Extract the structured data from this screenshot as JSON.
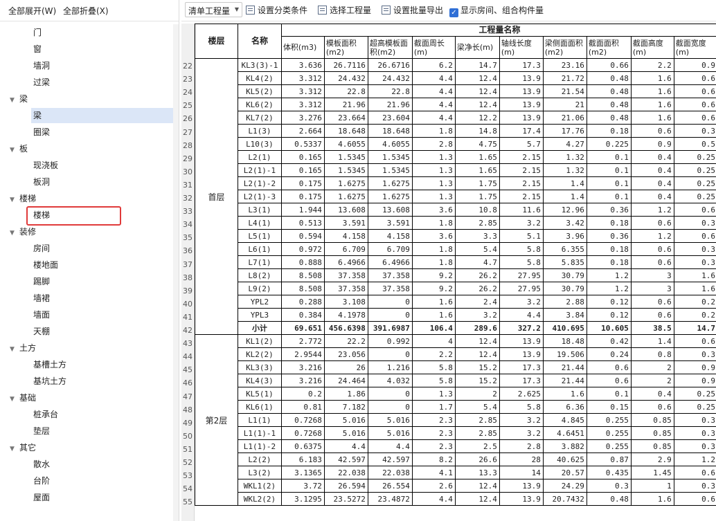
{
  "left_toolbar": {
    "expand_all": "全部展开(W)",
    "collapse_all": "全部折叠(X)"
  },
  "tree": [
    {
      "type": "child",
      "label": "门"
    },
    {
      "type": "child",
      "label": "窗"
    },
    {
      "type": "child",
      "label": "墙洞"
    },
    {
      "type": "child",
      "label": "过梁"
    },
    {
      "type": "parent",
      "label": "梁"
    },
    {
      "type": "child",
      "label": "梁",
      "selected": true
    },
    {
      "type": "child",
      "label": "圈梁"
    },
    {
      "type": "parent",
      "label": "板"
    },
    {
      "type": "child",
      "label": "现浇板"
    },
    {
      "type": "child",
      "label": "板洞"
    },
    {
      "type": "parent",
      "label": "楼梯"
    },
    {
      "type": "child",
      "label": "楼梯",
      "highlighted": true
    },
    {
      "type": "parent",
      "label": "装修"
    },
    {
      "type": "child",
      "label": "房间"
    },
    {
      "type": "child",
      "label": "楼地面"
    },
    {
      "type": "child",
      "label": "踢脚"
    },
    {
      "type": "child",
      "label": "墙裙"
    },
    {
      "type": "child",
      "label": "墙面"
    },
    {
      "type": "child",
      "label": "天棚"
    },
    {
      "type": "parent",
      "label": "土方"
    },
    {
      "type": "child",
      "label": "基槽土方"
    },
    {
      "type": "child",
      "label": "基坑土方"
    },
    {
      "type": "parent",
      "label": "基础"
    },
    {
      "type": "child",
      "label": "桩承台"
    },
    {
      "type": "child",
      "label": "垫层"
    },
    {
      "type": "parent",
      "label": "其它"
    },
    {
      "type": "child",
      "label": "散水"
    },
    {
      "type": "child",
      "label": "台阶"
    },
    {
      "type": "child",
      "label": "屋面"
    }
  ],
  "toolbar": {
    "select_value": "清单工程量",
    "set_classification": "设置分类条件",
    "select_quantity": "选择工程量",
    "set_batch_export": "设置批量导出",
    "show_rooms_label": "显示房间、组合构件量",
    "show_rooms_checked": true
  },
  "table": {
    "header_floor": "楼层",
    "header_name": "名称",
    "header_group": "工程量名称",
    "columns": [
      "体积(m3)",
      "模板面积(m2)",
      "超高模板面积(m2)",
      "截面周长(m)",
      "梁净长(m)",
      "轴线长度(m)",
      "梁侧面面积(m2)",
      "截面面积(m2)",
      "截面高度(m)",
      "截面宽度(m)"
    ],
    "floors": [
      {
        "name": "首层",
        "rows": [
          {
            "no": "22",
            "name": "KL3(3)-1",
            "v": [
              "3.636",
              "26.7116",
              "26.6716",
              "6.2",
              "14.7",
              "17.3",
              "23.16",
              "0.66",
              "2.2",
              "0.9"
            ]
          },
          {
            "no": "23",
            "name": "KL4(2)",
            "v": [
              "3.312",
              "24.432",
              "24.432",
              "4.4",
              "12.4",
              "13.9",
              "21.72",
              "0.48",
              "1.6",
              "0.6"
            ]
          },
          {
            "no": "24",
            "name": "KL5(2)",
            "v": [
              "3.312",
              "22.8",
              "22.8",
              "4.4",
              "12.4",
              "13.9",
              "21.54",
              "0.48",
              "1.6",
              "0.6"
            ]
          },
          {
            "no": "25",
            "name": "KL6(2)",
            "v": [
              "3.312",
              "21.96",
              "21.96",
              "4.4",
              "12.4",
              "13.9",
              "21",
              "0.48",
              "1.6",
              "0.6"
            ]
          },
          {
            "no": "26",
            "name": "KL7(2)",
            "v": [
              "3.276",
              "23.664",
              "23.604",
              "4.4",
              "12.2",
              "13.9",
              "21.06",
              "0.48",
              "1.6",
              "0.6"
            ]
          },
          {
            "no": "27",
            "name": "L1(3)",
            "v": [
              "2.664",
              "18.648",
              "18.648",
              "1.8",
              "14.8",
              "17.4",
              "17.76",
              "0.18",
              "0.6",
              "0.3"
            ]
          },
          {
            "no": "28",
            "name": "L10(3)",
            "v": [
              "0.5337",
              "4.6055",
              "4.6055",
              "2.8",
              "4.75",
              "5.7",
              "4.27",
              "0.225",
              "0.9",
              "0.5"
            ]
          },
          {
            "no": "29",
            "name": "L2(1)",
            "v": [
              "0.165",
              "1.5345",
              "1.5345",
              "1.3",
              "1.65",
              "2.15",
              "1.32",
              "0.1",
              "0.4",
              "0.25"
            ]
          },
          {
            "no": "30",
            "name": "L2(1)-1",
            "v": [
              "0.165",
              "1.5345",
              "1.5345",
              "1.3",
              "1.65",
              "2.15",
              "1.32",
              "0.1",
              "0.4",
              "0.25"
            ]
          },
          {
            "no": "31",
            "name": "L2(1)-2",
            "v": [
              "0.175",
              "1.6275",
              "1.6275",
              "1.3",
              "1.75",
              "2.15",
              "1.4",
              "0.1",
              "0.4",
              "0.25"
            ]
          },
          {
            "no": "32",
            "name": "L2(1)-3",
            "v": [
              "0.175",
              "1.6275",
              "1.6275",
              "1.3",
              "1.75",
              "2.15",
              "1.4",
              "0.1",
              "0.4",
              "0.25"
            ]
          },
          {
            "no": "33",
            "name": "L3(1)",
            "v": [
              "1.944",
              "13.608",
              "13.608",
              "3.6",
              "10.8",
              "11.6",
              "12.96",
              "0.36",
              "1.2",
              "0.6"
            ]
          },
          {
            "no": "34",
            "name": "L4(1)",
            "v": [
              "0.513",
              "3.591",
              "3.591",
              "1.8",
              "2.85",
              "3.2",
              "3.42",
              "0.18",
              "0.6",
              "0.3"
            ]
          },
          {
            "no": "35",
            "name": "L5(1)",
            "v": [
              "0.594",
              "4.158",
              "4.158",
              "3.6",
              "3.3",
              "5.1",
              "3.96",
              "0.36",
              "1.2",
              "0.6"
            ]
          },
          {
            "no": "36",
            "name": "L6(1)",
            "v": [
              "0.972",
              "6.709",
              "6.709",
              "1.8",
              "5.4",
              "5.8",
              "6.355",
              "0.18",
              "0.6",
              "0.3"
            ]
          },
          {
            "no": "37",
            "name": "L7(1)",
            "v": [
              "0.888",
              "6.4966",
              "6.4966",
              "1.8",
              "4.7",
              "5.8",
              "5.835",
              "0.18",
              "0.6",
              "0.3"
            ]
          },
          {
            "no": "38",
            "name": "L8(2)",
            "v": [
              "8.508",
              "37.358",
              "37.358",
              "9.2",
              "26.2",
              "27.95",
              "30.79",
              "1.2",
              "3",
              "1.6"
            ]
          },
          {
            "no": "39",
            "name": "L9(2)",
            "v": [
              "8.508",
              "37.358",
              "37.358",
              "9.2",
              "26.2",
              "27.95",
              "30.79",
              "1.2",
              "3",
              "1.6"
            ]
          },
          {
            "no": "40",
            "name": "YPL2",
            "v": [
              "0.288",
              "3.108",
              "0",
              "1.6",
              "2.4",
              "3.2",
              "2.88",
              "0.12",
              "0.6",
              "0.2"
            ]
          },
          {
            "no": "41",
            "name": "YPL3",
            "v": [
              "0.384",
              "4.1978",
              "0",
              "1.6",
              "3.2",
              "4.4",
              "3.84",
              "0.12",
              "0.6",
              "0.2"
            ]
          },
          {
            "no": "42",
            "name": "小计",
            "subtotal": true,
            "v": [
              "69.651",
              "456.6398",
              "391.6987",
              "106.4",
              "289.6",
              "327.2",
              "410.695",
              "10.605",
              "38.5",
              "14.7"
            ]
          }
        ]
      },
      {
        "name": "第2层",
        "rows": [
          {
            "no": "43",
            "name": "KL1(2)",
            "v": [
              "2.772",
              "22.2",
              "0.992",
              "4",
              "12.4",
              "13.9",
              "18.48",
              "0.42",
              "1.4",
              "0.6"
            ]
          },
          {
            "no": "44",
            "name": "KL2(2)",
            "v": [
              "2.9544",
              "23.056",
              "0",
              "2.2",
              "12.4",
              "13.9",
              "19.506",
              "0.24",
              "0.8",
              "0.3"
            ]
          },
          {
            "no": "45",
            "name": "KL3(3)",
            "v": [
              "3.216",
              "26",
              "1.216",
              "5.8",
              "15.2",
              "17.3",
              "21.44",
              "0.6",
              "2",
              "0.9"
            ]
          },
          {
            "no": "46",
            "name": "KL4(3)",
            "v": [
              "3.216",
              "24.464",
              "4.032",
              "5.8",
              "15.2",
              "17.3",
              "21.44",
              "0.6",
              "2",
              "0.9"
            ]
          },
          {
            "no": "47",
            "name": "KL5(1)",
            "v": [
              "0.2",
              "1.86",
              "0",
              "1.3",
              "2",
              "2.625",
              "1.6",
              "0.1",
              "0.4",
              "0.25"
            ]
          },
          {
            "no": "48",
            "name": "KL6(1)",
            "v": [
              "0.81",
              "7.182",
              "0",
              "1.7",
              "5.4",
              "5.8",
              "6.36",
              "0.15",
              "0.6",
              "0.25"
            ]
          },
          {
            "no": "49",
            "name": "L1(1)",
            "v": [
              "0.7268",
              "5.016",
              "5.016",
              "2.3",
              "2.85",
              "3.2",
              "4.845",
              "0.255",
              "0.85",
              "0.3"
            ]
          },
          {
            "no": "50",
            "name": "L1(1)-1",
            "v": [
              "0.7268",
              "5.016",
              "5.016",
              "2.3",
              "2.85",
              "3.2",
              "4.6451",
              "0.255",
              "0.85",
              "0.3"
            ]
          },
          {
            "no": "51",
            "name": "L1(1)-2",
            "v": [
              "0.6375",
              "4.4",
              "4.4",
              "2.3",
              "2.5",
              "2.8",
              "3.882",
              "0.255",
              "0.85",
              "0.3"
            ]
          },
          {
            "no": "52",
            "name": "L2(2)",
            "v": [
              "6.183",
              "42.597",
              "42.597",
              "8.2",
              "26.6",
              "28",
              "40.625",
              "0.87",
              "2.9",
              "1.2"
            ]
          },
          {
            "no": "53",
            "name": "L3(2)",
            "v": [
              "3.1365",
              "22.038",
              "22.038",
              "4.1",
              "13.3",
              "14",
              "20.57",
              "0.435",
              "1.45",
              "0.6"
            ]
          },
          {
            "no": "54",
            "name": "WKL1(2)",
            "v": [
              "3.72",
              "26.594",
              "26.554",
              "2.6",
              "12.4",
              "13.9",
              "24.29",
              "0.3",
              "1",
              "0.3"
            ]
          },
          {
            "no": "55",
            "name": "WKL2(2)",
            "v": [
              "3.1295",
              "23.5272",
              "23.4872",
              "4.4",
              "12.4",
              "13.9",
              "20.7432",
              "0.48",
              "1.6",
              "0.6"
            ]
          }
        ]
      }
    ]
  }
}
